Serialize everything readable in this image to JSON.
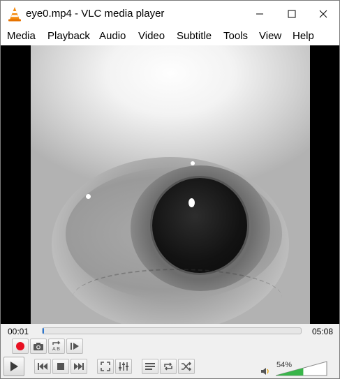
{
  "window": {
    "title": "eye0.mp4 - VLC media player",
    "minimize_icon": "minimize-icon",
    "maximize_icon": "maximize-icon",
    "close_icon": "close-icon"
  },
  "menu": {
    "items": [
      "Media",
      "Playback",
      "Audio",
      "Video",
      "Subtitle",
      "Tools",
      "View",
      "Help"
    ]
  },
  "player": {
    "elapsed": "00:01",
    "total": "05:08",
    "progress": 0.003
  },
  "volume": {
    "label": "54%",
    "level": 0.54,
    "fill_color": "#39b54a"
  },
  "colors": {
    "record": "#e81123",
    "seek_fill": "#2a78d6"
  },
  "icons": {
    "record": "record-icon",
    "snapshot": "camera-icon",
    "loop_ab": "loop-ab-icon",
    "frame_step": "frame-step-icon",
    "play": "play-icon",
    "previous": "previous-icon",
    "stop": "stop-icon",
    "next": "next-icon",
    "fullscreen": "fullscreen-icon",
    "extended": "equalizer-icon",
    "playlist": "playlist-icon",
    "loop": "loop-icon",
    "shuffle": "shuffle-icon",
    "speaker": "speaker-icon"
  }
}
